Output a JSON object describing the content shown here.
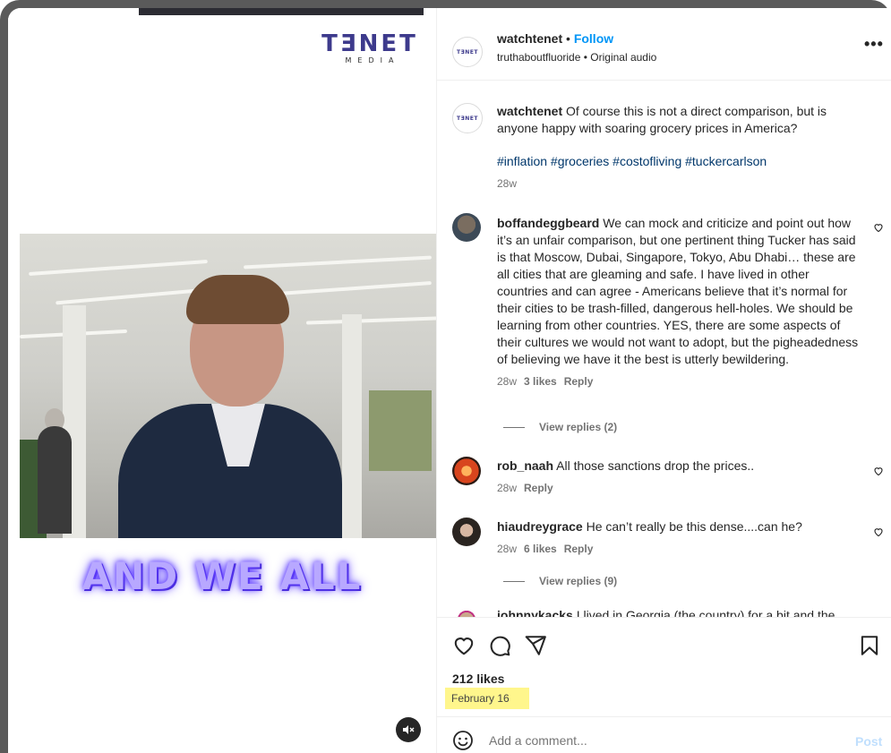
{
  "video": {
    "brand": {
      "name": "TƎNET",
      "sub": "MEDIA"
    },
    "caption": "AND WE ALL",
    "mute_icon": "speaker-muted-icon"
  },
  "post": {
    "author": "watchtenet",
    "separator": "•",
    "follow_label": "Follow",
    "audio_line": "truthaboutfluoride • Original audio",
    "more_label": "•••",
    "avatar_text": "TƎNET"
  },
  "caption_comment": {
    "user": "watchtenet",
    "text": "Of course this is not a direct comparison, but is anyone happy with soaring grocery prices in America?",
    "hashtags": "#inflation #groceries #costofliving #tuckercarlson",
    "age": "28w"
  },
  "comments": [
    {
      "user": "boffandeggbeard",
      "text": "We can mock and criticize and point out how it’s an unfair comparison, but one pertinent thing Tucker has said is that Moscow, Dubai, Singapore, Tokyo, Abu Dhabi… these are all cities that are gleaming and safe. I have lived in other countries and can agree - Americans believe that it’s normal for their cities to be trash-filled, dangerous hell-holes. We should be learning from other countries. YES, there are some aspects of their cultures we would not want to adopt, but the pigheadedness of believing we have it the best is utterly bewildering.",
      "age": "28w",
      "likes": "3 likes",
      "reply": "Reply",
      "view_replies": "View replies (2)"
    },
    {
      "user": "rob_naah",
      "text": "All those sanctions drop the prices..",
      "age": "28w",
      "reply": "Reply"
    },
    {
      "user": "hiaudreygrace",
      "text": "He can’t really be this dense....can he?",
      "age": "28w",
      "likes": "6 likes",
      "reply": "Reply",
      "view_replies": "View replies (9)"
    },
    {
      "user": "johnnykacks",
      "text": "I lived in Georgia (the country) for a bit and the"
    }
  ],
  "actions": {
    "like_icon": "heart-icon",
    "comment_icon": "comment-bubble-icon",
    "share_icon": "paper-plane-icon",
    "save_icon": "bookmark-icon",
    "likes": "212 likes",
    "date": "February 16"
  },
  "add_comment": {
    "placeholder": "Add a comment...",
    "post_label": "Post",
    "emoji_icon": "emoji-smile-icon"
  },
  "colors": {
    "link": "#0095f6",
    "hashtag": "#00376b",
    "highlight": "#fff68c",
    "caption_glow": "#6a48ff"
  }
}
